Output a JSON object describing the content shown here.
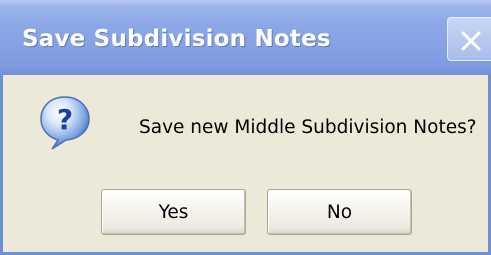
{
  "dialog": {
    "title": "Save Subdivision Notes",
    "message": "Save new Middle Subdivision Notes?",
    "icon": "question-icon",
    "close_icon": "close-icon"
  },
  "buttons": {
    "yes_label": "Yes",
    "no_label": "No"
  },
  "colors": {
    "titlebar": "#8DA8E6",
    "dialog_background": "#ECE9D8",
    "title_text": "#FFFFFF"
  }
}
